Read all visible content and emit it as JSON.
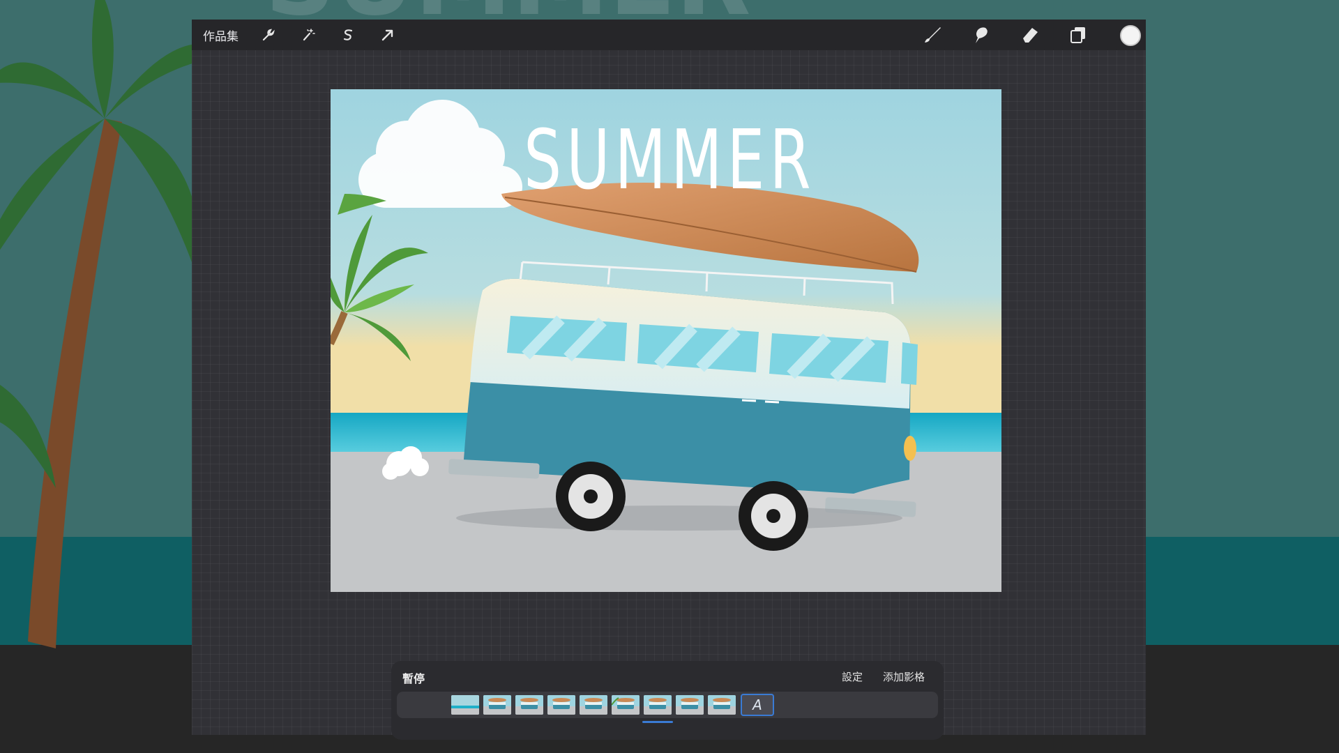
{
  "toolbar": {
    "gallery_label": "作品集",
    "left_tools": [
      "wrench-icon",
      "magic-wand-icon",
      "selection-s-icon",
      "transform-arrow-icon"
    ],
    "right_tools": [
      "brush-icon",
      "smudge-icon",
      "eraser-icon",
      "layers-icon"
    ],
    "current_color": "#f4f4f4"
  },
  "artwork": {
    "title_text": "SUMMER"
  },
  "animation": {
    "status": "暫停",
    "settings_label": "設定",
    "add_frame_label": "添加影格",
    "frame_count": 9,
    "current_frame": 7,
    "add_frame_glyph": "A"
  },
  "colors": {
    "accent": "#3a7bd5",
    "sky": "#9fd4e0",
    "sea": "#1fb0c8",
    "van_teal": "#3b8fa6",
    "surfboard": "#c98955"
  }
}
